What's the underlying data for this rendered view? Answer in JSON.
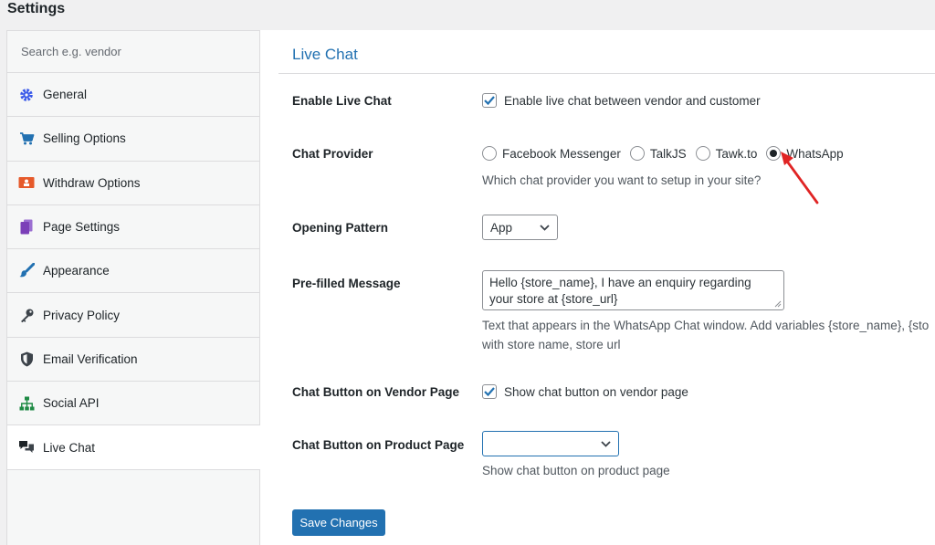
{
  "page": {
    "title": "Settings"
  },
  "sidebar": {
    "search_placeholder": "Search e.g. vendor",
    "items": [
      {
        "label": "General",
        "icon": "gear-icon",
        "color": "#3858e9"
      },
      {
        "label": "Selling Options",
        "icon": "cart-icon",
        "color": "#2271b1"
      },
      {
        "label": "Withdraw Options",
        "icon": "withdraw-icon",
        "color": "#e65a2b"
      },
      {
        "label": "Page Settings",
        "icon": "pages-icon",
        "color": "#7b3fb8"
      },
      {
        "label": "Appearance",
        "icon": "brush-icon",
        "color": "#2271b1"
      },
      {
        "label": "Privacy Policy",
        "icon": "key-icon",
        "color": "#3c434a"
      },
      {
        "label": "Email Verification",
        "icon": "shield-icon",
        "color": "#3c434a"
      },
      {
        "label": "Social API",
        "icon": "network-icon",
        "color": "#1e8a44"
      },
      {
        "label": "Live Chat",
        "icon": "chat-icon",
        "color": "#1d2327",
        "active": true
      }
    ]
  },
  "main": {
    "title": "Live Chat",
    "enable": {
      "label": "Enable Live Chat",
      "checkbox_label": "Enable live chat between vendor and customer",
      "checked": true
    },
    "provider": {
      "label": "Chat Provider",
      "options": [
        "Facebook Messenger",
        "TalkJS",
        "Tawk.to",
        "WhatsApp"
      ],
      "selected": "WhatsApp",
      "help": "Which chat provider you want to setup in your site?"
    },
    "opening": {
      "label": "Opening Pattern",
      "value": "App"
    },
    "prefilled": {
      "label": "Pre-filled Message",
      "line1": "Hello {store_name}, I have an enquiry regarding",
      "line2": "your store at {store_url}",
      "help_line1": "Text that appears in the WhatsApp Chat window. Add variables {store_name}, {sto",
      "help_line2": "with store name, store url"
    },
    "vendor_page": {
      "label": "Chat Button on Vendor Page",
      "checkbox_label": "Show chat button on vendor page",
      "checked": true
    },
    "product_page": {
      "label": "Chat Button on Product Page",
      "value": "",
      "help": "Show chat button on product page"
    },
    "save_label": "Save Changes"
  },
  "colors": {
    "accent": "#2271b1",
    "arrow": "#e02424"
  }
}
